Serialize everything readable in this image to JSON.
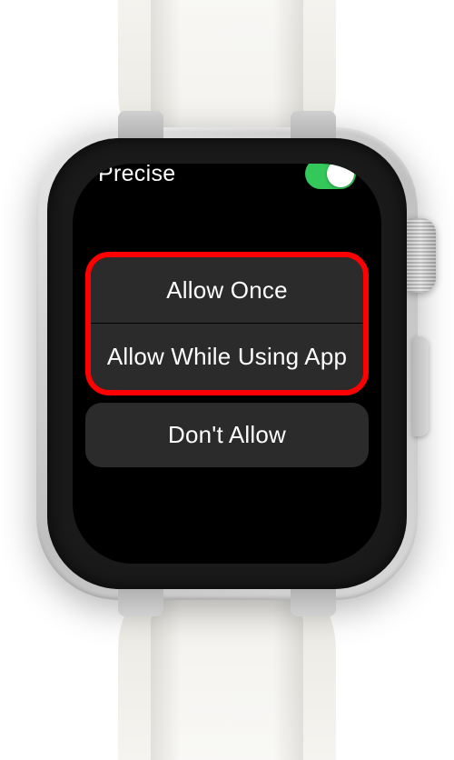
{
  "precise": {
    "label": "Precise",
    "toggle_on": true
  },
  "options": {
    "allow_once": "Allow Once",
    "allow_while_using": "Allow While Using App",
    "dont_allow": "Don't Allow"
  },
  "colors": {
    "toggle_green": "#34c759",
    "highlight_red": "#ff0000",
    "button_bg": "#2b2b2b"
  }
}
